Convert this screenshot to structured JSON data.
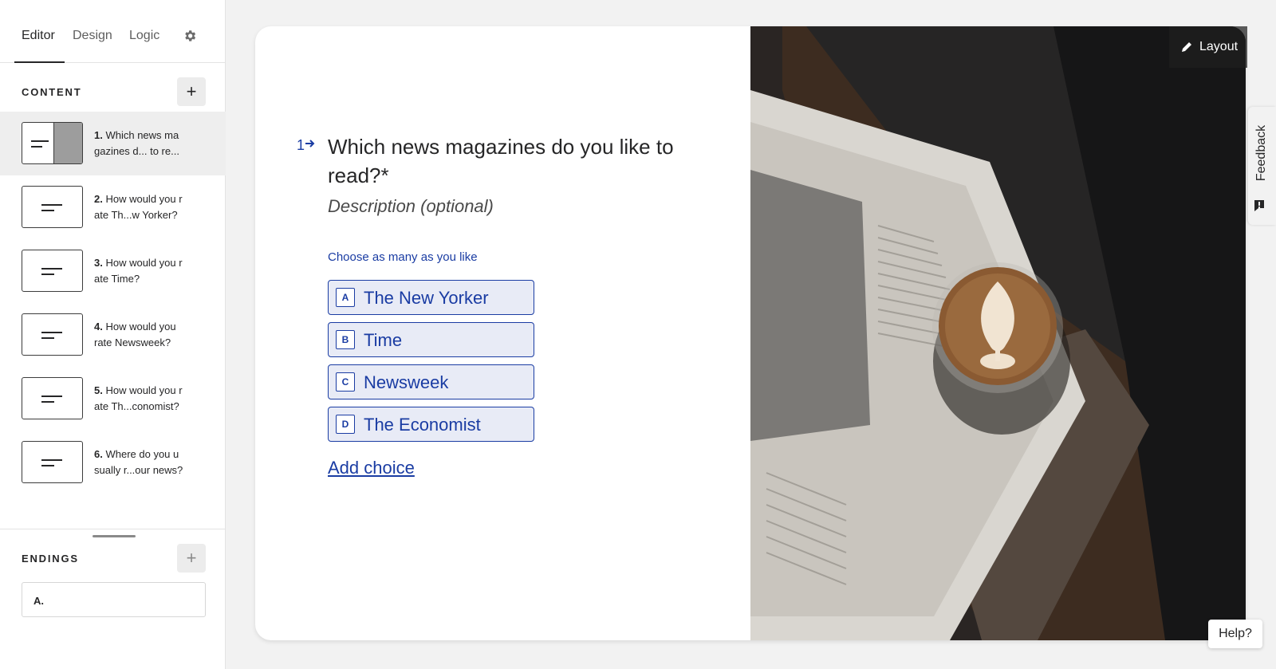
{
  "tabs": {
    "editor": "Editor",
    "design": "Design",
    "logic": "Logic"
  },
  "content": {
    "heading": "CONTENT",
    "add": "+",
    "questions": [
      {
        "num": "1.",
        "text": "Which news ma gazines d... to re..."
      },
      {
        "num": "2.",
        "text": "How would you r ate Th...w Yorker?"
      },
      {
        "num": "3.",
        "text": "How would you r ate Time?"
      },
      {
        "num": "4.",
        "text": "How would you rate Newsweek?"
      },
      {
        "num": "5.",
        "text": "How would you r ate Th...conomist?"
      },
      {
        "num": "6.",
        "text": "Where do you u sually r...our news?"
      }
    ]
  },
  "endings": {
    "heading": "ENDINGS",
    "add": "+",
    "items": [
      "A."
    ]
  },
  "question": {
    "number": "1",
    "title": "Which news magazines do you like to read?*",
    "description": "Description (optional)",
    "hint": "Choose as many as you like",
    "choices": [
      {
        "key": "A",
        "label": "The New Yorker"
      },
      {
        "key": "B",
        "label": "Time"
      },
      {
        "key": "C",
        "label": "Newsweek"
      },
      {
        "key": "D",
        "label": "The Economist"
      }
    ],
    "add_choice": "Add choice"
  },
  "toolbar": {
    "layout": "Layout"
  },
  "feedback": "Feedback",
  "help": "Help?",
  "colors": {
    "accent": "#1a3ca3",
    "choice_bg": "#e8ebf6"
  },
  "icons": [
    "gear-icon",
    "arrow-right-icon",
    "pencil-icon",
    "feedback-icon"
  ]
}
